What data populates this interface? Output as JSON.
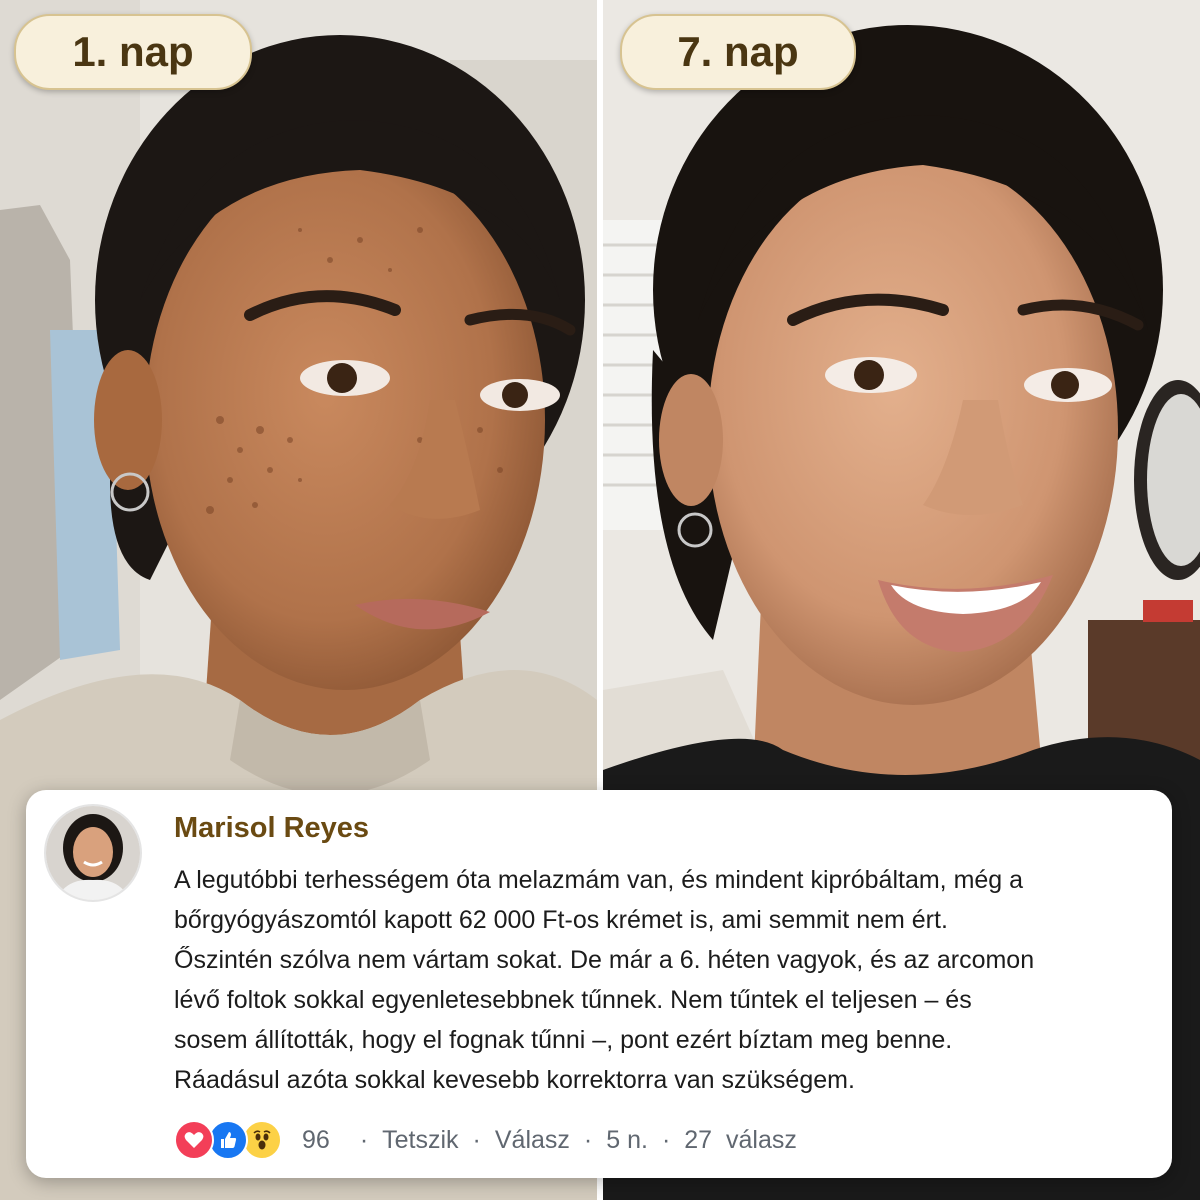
{
  "before_label": "1. nap",
  "after_label": "7. nap",
  "comment": {
    "author": "Marisol Reyes",
    "lines": [
      "A legutóbbi terhességem óta melazmám van, és mindent kipróbáltam, még a",
      "bőrgyógyászomtól kapott 62 000 Ft-os krémet is, ami semmit nem ért.",
      "Őszintén szólva nem vártam sokat. De már a 6. héten vagyok, és az arcomon",
      "lévő foltok sokkal egyenletesebbnek tűnnek. Nem tűntek el teljesen – és",
      "sosem állították, hogy el fognak tűnni –, pont ezért bíztam meg benne.",
      "Ráadásul azóta sokkal kevesebb korrektorra van szükségem."
    ],
    "reaction_icons": [
      "heart-reaction-icon",
      "like-reaction-icon",
      "wow-reaction-icon"
    ],
    "reaction_count": "96",
    "like_label": "Tetszik",
    "reply_label": "Válasz",
    "time": "5 n.",
    "replies": "27  válasz",
    "separator": "·"
  },
  "colors": {
    "badge_bg": "#f8f0dc",
    "badge_text": "#4a3612",
    "author": "#6a4a12",
    "meta": "#606770",
    "love": "#f33e58",
    "like": "#1877f2",
    "wow": "#fcd146"
  }
}
